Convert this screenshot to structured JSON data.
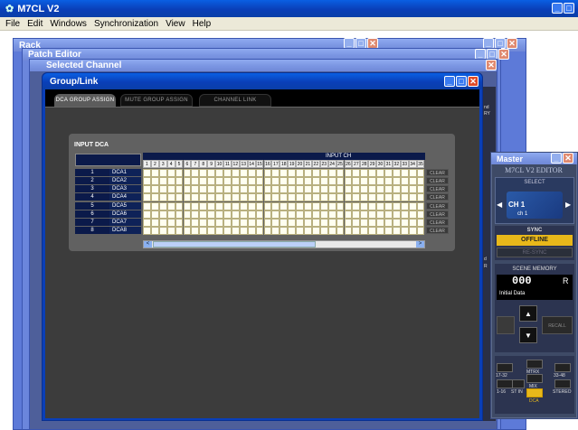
{
  "app": {
    "title": "M7CL V2"
  },
  "menu": [
    "File",
    "Edit",
    "Windows",
    "Synchronization",
    "View",
    "Help"
  ],
  "windows": {
    "rack": "Rack",
    "patch": "Patch Editor",
    "selected": "Selected Channel",
    "group": "Group/Link",
    "master": "Master"
  },
  "tabs": [
    {
      "label": "DCA GROUP ASSIGN"
    },
    {
      "label": "MUTE GROUP ASSIGN"
    },
    {
      "label": "CHANNEL LINK"
    }
  ],
  "section": {
    "label": "INPUT DCA",
    "input_ch": "INPUT CH"
  },
  "channels": [
    "1",
    "2",
    "3",
    "4",
    "5",
    "6",
    "7",
    "8",
    "9",
    "10",
    "11",
    "12",
    "13",
    "14",
    "15",
    "16",
    "17",
    "18",
    "19",
    "20",
    "21",
    "22",
    "23",
    "24",
    "25",
    "26",
    "27",
    "28",
    "29",
    "30",
    "31",
    "32",
    "33",
    "34",
    "35"
  ],
  "dca": [
    {
      "num": "1",
      "name": "DCA1"
    },
    {
      "num": "2",
      "name": "DCA2"
    },
    {
      "num": "3",
      "name": "DCA3"
    },
    {
      "num": "4",
      "name": "DCA4"
    },
    {
      "num": "5",
      "name": "DCA5"
    },
    {
      "num": "6",
      "name": "DCA6"
    },
    {
      "num": "7",
      "name": "DCA7"
    },
    {
      "num": "8",
      "name": "DCA8"
    }
  ],
  "clear_label": "CLEAR",
  "master": {
    "editor_title": "M7CL V2 EDITOR",
    "select": "SELECT",
    "channel": "CH 1",
    "channel_sub": "ch 1",
    "sync": "SYNC",
    "offline": "OFFLINE",
    "resync": "RE-SYNC",
    "scene_memory": "SCENE MEMORY",
    "scene_no": "000",
    "scene_r": "R",
    "scene_name": "Initial Data",
    "recall": "RECALL",
    "banks": [
      "17-32",
      "33-48",
      "1-16",
      "ST IN",
      "MTRX",
      "MIX",
      "STEREO",
      "DCA"
    ]
  },
  "side_labels": [
    "nd",
    "RY",
    "d",
    "R"
  ]
}
